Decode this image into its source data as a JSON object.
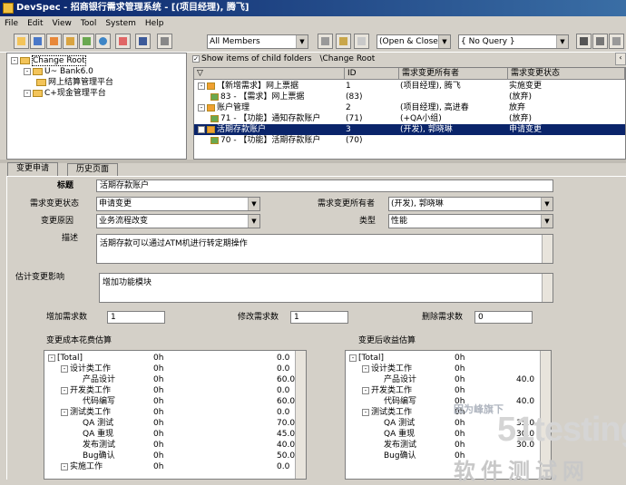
{
  "app": {
    "title": "DevSpec - 招商银行需求管理系统 - [(项目经理), 腾飞]"
  },
  "menu": [
    "File",
    "Edit",
    "View",
    "Tool",
    "System",
    "Help"
  ],
  "filters": {
    "members": "All Members",
    "status": "(Open & Closed)",
    "query": "{ No Query }"
  },
  "left_tree": [
    {
      "label": "Change Root",
      "level": 0
    },
    {
      "label": "U~ Bank6.0",
      "level": 1
    },
    {
      "label": "网上结算管理平台",
      "level": 2
    },
    {
      "label": "C+现金管理平台",
      "level": 1
    }
  ],
  "show_child_folders": {
    "label": "Show items of child folders",
    "path": "\\Change Root"
  },
  "grid": {
    "columns": [
      "ID",
      "需求变更所有者",
      "需求变更状态"
    ],
    "rows": [
      {
        "name": "【新增需求】网上票据",
        "id": "1",
        "owner": "(项目经理), 腾飞",
        "status": "实施变更",
        "level": 0
      },
      {
        "name": "83 - 【需求】网上票据",
        "id": "(83)",
        "owner": "",
        "status": "(放弃)",
        "level": 1
      },
      {
        "name": "账户管理",
        "id": "2",
        "owner": "(项目经理), 高进春",
        "status": "放弃",
        "level": 0
      },
      {
        "name": "71 - 【功能】通知存款账户",
        "id": "(71)",
        "owner": "(+QA小组)",
        "status": "(放弃)",
        "level": 1
      },
      {
        "name": "活期存款账户",
        "id": "3",
        "owner": "(开发), 郭晓琳",
        "status": "申请变更",
        "level": 0,
        "selected": true
      },
      {
        "name": "70 - 【功能】活期存款账户",
        "id": "(70)",
        "owner": "",
        "status": "",
        "level": 1
      }
    ]
  },
  "tabs": [
    "变更申请",
    "历史页面"
  ],
  "form": {
    "title_label": "标题",
    "title_value": "活期存款账户",
    "status_label": "需求变更状态",
    "status_value": "申请变更",
    "owner_label": "需求变更所有者",
    "owner_value": "(开发), 郭晓琳",
    "reason_label": "变更原因",
    "reason_value": "业务流程改变",
    "type_label": "类型",
    "type_value": "性能",
    "desc_label": "描述",
    "desc_value": "活期存款可以通过ATM机进行转定期操作",
    "impact_label": "估计变更影响",
    "impact_value": "增加功能模块",
    "add_label": "增加需求数",
    "add_value": "1",
    "modify_label": "修改需求数",
    "modify_value": "1",
    "delete_label": "删除需求数",
    "delete_value": "0",
    "cost_label": "变更成本花费估算",
    "benefit_label": "变更后收益估算"
  },
  "cost": [
    {
      "t": "[Total]",
      "l": 0,
      "a": "0h",
      "b": "0.0"
    },
    {
      "t": "设计类工作",
      "l": 1,
      "a": "0h",
      "b": "0.0"
    },
    {
      "t": "产品设计",
      "l": 2,
      "a": "0h",
      "b": "60.0"
    },
    {
      "t": "开发类工作",
      "l": 1,
      "a": "0h",
      "b": "0.0"
    },
    {
      "t": "代码编写",
      "l": 2,
      "a": "0h",
      "b": "60.0"
    },
    {
      "t": "测试类工作",
      "l": 1,
      "a": "0h",
      "b": "0.0"
    },
    {
      "t": "QA 测试",
      "l": 2,
      "a": "0h",
      "b": "70.0"
    },
    {
      "t": "QA 重现",
      "l": 2,
      "a": "0h",
      "b": "45.0"
    },
    {
      "t": "发布测试",
      "l": 2,
      "a": "0h",
      "b": "40.0"
    },
    {
      "t": "Bug确认",
      "l": 2,
      "a": "0h",
      "b": "50.0"
    },
    {
      "t": "实施工作",
      "l": 1,
      "a": "0h",
      "b": "0.0"
    }
  ],
  "benefit": [
    {
      "t": "[Total]",
      "l": 0,
      "a": "0h",
      "b": ""
    },
    {
      "t": "设计类工作",
      "l": 1,
      "a": "0h",
      "b": ""
    },
    {
      "t": "产品设计",
      "l": 2,
      "a": "0h",
      "b": "40.0"
    },
    {
      "t": "开发类工作",
      "l": 1,
      "a": "0h",
      "b": ""
    },
    {
      "t": "代码编写",
      "l": 2,
      "a": "0h",
      "b": "40.0"
    },
    {
      "t": "测试类工作",
      "l": 1,
      "a": "0h",
      "b": ""
    },
    {
      "t": "QA 测试",
      "l": 2,
      "a": "0h",
      "b": "35.0"
    },
    {
      "t": "QA 重现",
      "l": 2,
      "a": "0h",
      "b": "30.0"
    },
    {
      "t": "发布测试",
      "l": 2,
      "a": "0h",
      "b": "30.0"
    },
    {
      "t": "Bug确认",
      "l": 2,
      "a": "0h",
      "b": ""
    }
  ],
  "watermark": {
    "line1": "因为峰旗下",
    "line2": "51testing",
    "line3": "软件测试网"
  }
}
